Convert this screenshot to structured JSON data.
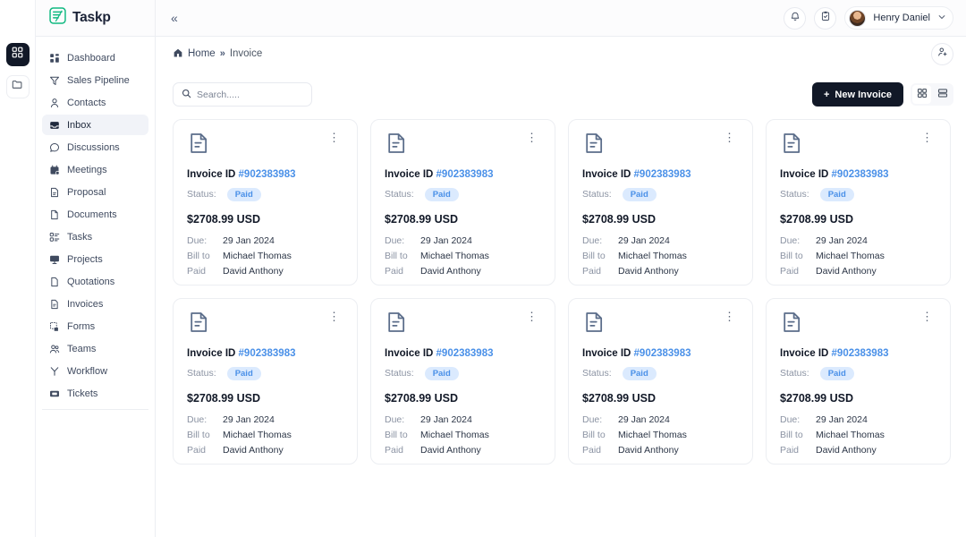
{
  "brand": {
    "name": "Taskp",
    "logo_icon": "taskp-logo-icon",
    "accent": "#10b981"
  },
  "rail": {
    "items": [
      {
        "name": "apps-grid-icon",
        "active": true
      },
      {
        "name": "folder-icon",
        "active": false
      }
    ]
  },
  "sidebar": {
    "items": [
      {
        "label": "Dashboard",
        "icon": "dashboard-grid-icon",
        "active": false
      },
      {
        "label": "Sales Pipeline",
        "icon": "funnel-icon",
        "active": false
      },
      {
        "label": "Contacts",
        "icon": "person-icon",
        "active": false
      },
      {
        "label": "Inbox",
        "icon": "inbox-icon",
        "active": true
      },
      {
        "label": "Discussions",
        "icon": "chat-bubble-icon",
        "active": false
      },
      {
        "label": "Meetings",
        "icon": "calendar-icon",
        "active": false
      },
      {
        "label": "Proposal",
        "icon": "document-proposal-icon",
        "active": false
      },
      {
        "label": "Documents",
        "icon": "document-icon",
        "active": false
      },
      {
        "label": "Tasks",
        "icon": "task-list-icon",
        "active": false
      },
      {
        "label": "Projects",
        "icon": "monitor-icon",
        "active": false
      },
      {
        "label": "Quotations",
        "icon": "page-icon",
        "active": false
      },
      {
        "label": "Invoices",
        "icon": "invoice-icon",
        "active": false
      },
      {
        "label": "Forms",
        "icon": "forms-icon",
        "active": false
      },
      {
        "label": "Teams",
        "icon": "people-icon",
        "active": false
      },
      {
        "label": "Workflow",
        "icon": "workflow-icon",
        "active": false
      },
      {
        "label": "Tickets",
        "icon": "ticket-icon",
        "active": false
      }
    ]
  },
  "topbar": {
    "collapse_icon": "chevron-double-left-icon",
    "collapse_label": "«",
    "notification_icon": "bell-icon",
    "tasks_icon": "clipboard-check-icon",
    "user": {
      "name": "Henry Daniel",
      "avatar": "user-avatar",
      "chevron": "chevron-down-icon"
    }
  },
  "breadcrumb": {
    "home_icon": "home-icon",
    "home": "Home",
    "separator": "»",
    "current": "Invoice",
    "add_user_icon": "add-user-icon"
  },
  "toolbar": {
    "search": {
      "placeholder": "Search.....",
      "value": "",
      "icon": "search-icon"
    },
    "new_invoice_label": "New Invoice",
    "new_invoice_plus": "+",
    "grid_view_icon": "grid-view-icon",
    "list_view_icon": "list-view-icon",
    "active_view": "grid"
  },
  "invoice_card_labels": {
    "id_prefix": "Invoice ID",
    "status_label": "Status:",
    "due_label": "Due:",
    "bill_to_label": "Bill to",
    "paid_label": "Paid",
    "menu_icon": "kebab-menu-icon",
    "doc_icon": "invoice-document-icon"
  },
  "invoices": [
    {
      "id": "#902383983",
      "status": "Paid",
      "amount": "$2708.99 USD",
      "due": "29 Jan 2024",
      "bill_to": "Michael Thomas",
      "paid_by": "David Anthony"
    },
    {
      "id": "#902383983",
      "status": "Paid",
      "amount": "$2708.99 USD",
      "due": "29 Jan 2024",
      "bill_to": "Michael Thomas",
      "paid_by": "David Anthony"
    },
    {
      "id": "#902383983",
      "status": "Paid",
      "amount": "$2708.99 USD",
      "due": "29 Jan 2024",
      "bill_to": "Michael Thomas",
      "paid_by": "David Anthony"
    },
    {
      "id": "#902383983",
      "status": "Paid",
      "amount": "$2708.99 USD",
      "due": "29 Jan 2024",
      "bill_to": "Michael Thomas",
      "paid_by": "David Anthony"
    },
    {
      "id": "#902383983",
      "status": "Paid",
      "amount": "$2708.99 USD",
      "due": "29 Jan 2024",
      "bill_to": "Michael Thomas",
      "paid_by": "David Anthony"
    },
    {
      "id": "#902383983",
      "status": "Paid",
      "amount": "$2708.99 USD",
      "due": "29 Jan 2024",
      "bill_to": "Michael Thomas",
      "paid_by": "David Anthony"
    },
    {
      "id": "#902383983",
      "status": "Paid",
      "amount": "$2708.99 USD",
      "due": "29 Jan 2024",
      "bill_to": "Michael Thomas",
      "paid_by": "David Anthony"
    },
    {
      "id": "#902383983",
      "status": "Paid",
      "amount": "$2708.99 USD",
      "due": "29 Jan 2024",
      "bill_to": "Michael Thomas",
      "paid_by": "David Anthony"
    }
  ],
  "colors": {
    "accent_blue": "#4a90e8",
    "badge_bg": "#dbeafe",
    "dark_button": "#111827",
    "brand_green": "#10b981"
  }
}
